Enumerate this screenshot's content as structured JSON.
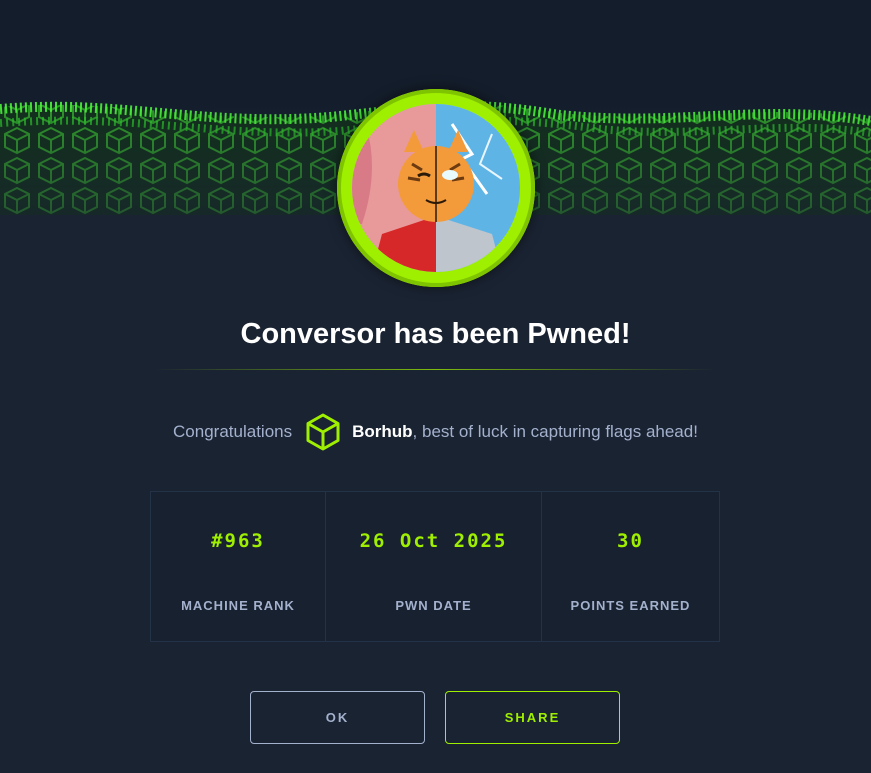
{
  "dialog": {
    "title": "Conversor has been Pwned!",
    "congrats_prefix": "Congratulations",
    "username": "Borhub",
    "congrats_suffix": ", best of luck in capturing flags ahead!",
    "user_icon": "hexagon-cube-icon"
  },
  "stats": [
    {
      "value": "#963",
      "label": "MACHINE RANK"
    },
    {
      "value": "26 Oct 2025",
      "label": "PWN DATE"
    },
    {
      "value": "30",
      "label": "POINTS EARNED"
    }
  ],
  "buttons": {
    "ok_label": "OK",
    "share_label": "SHARE"
  },
  "colors": {
    "accent": "#9fef00",
    "background": "#1a2332",
    "muted_text": "#a4b1cd"
  }
}
